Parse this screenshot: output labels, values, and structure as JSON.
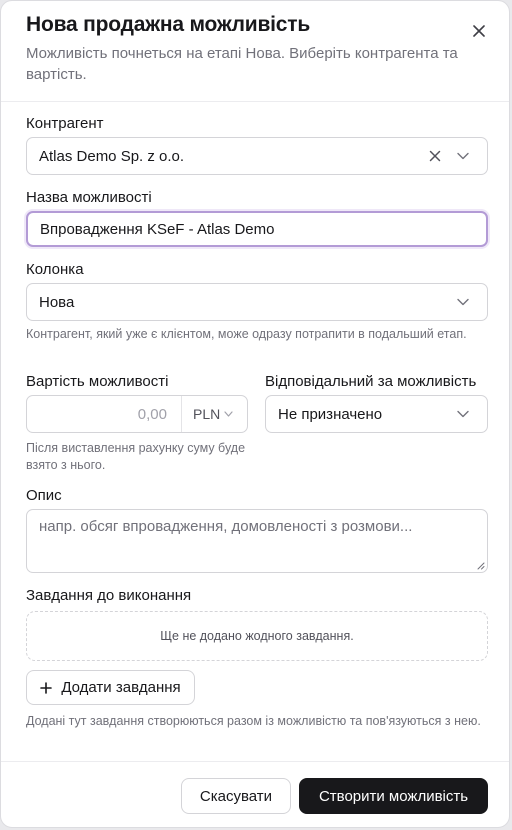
{
  "dialog": {
    "title": "Нова продажна можливість",
    "subtitle": "Можливість почнеться на етапі Нова. Виберіть контрагента та вартість."
  },
  "contractor": {
    "label": "Контрагент",
    "value": "Atlas Demo Sp. z o.o."
  },
  "name": {
    "label": "Назва можливості",
    "value": "Впровадження KSeF - Atlas Demo"
  },
  "column": {
    "label": "Колонка",
    "value": "Нова",
    "help": "Контрагент, який уже є клієнтом, може одразу потрапити в подальший етап."
  },
  "value_field": {
    "label": "Вартість можливості",
    "amount": "0,00",
    "currency": "PLN",
    "help": "Після виставлення рахунку суму буде взято з нього."
  },
  "owner": {
    "label": "Відповідальний за можливість",
    "value": "Не призначено"
  },
  "description": {
    "label": "Опис",
    "placeholder": "напр. обсяг впровадження, домовленості з розмови..."
  },
  "tasks": {
    "label": "Завдання до виконання",
    "empty": "Ще не додано жодного завдання.",
    "add_label": "Додати завдання",
    "help": "Додані тут завдання створюються разом із можливістю та пов'язуються з нею."
  },
  "footer": {
    "cancel": "Скасувати",
    "submit": "Створити можливість"
  }
}
